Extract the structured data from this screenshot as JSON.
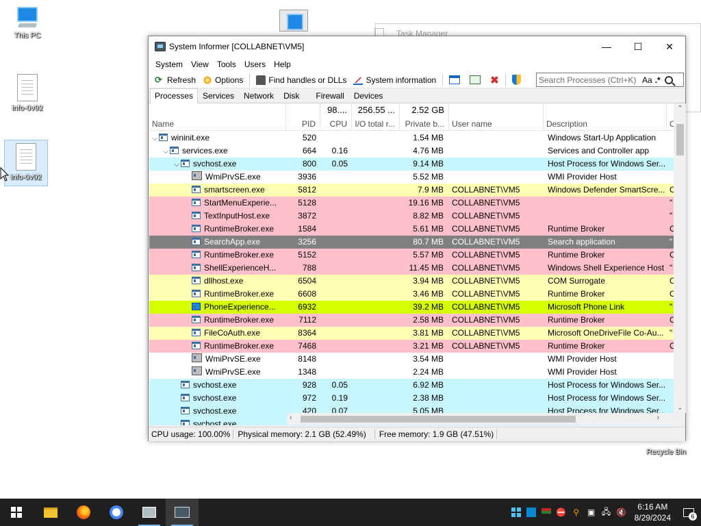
{
  "desktop": {
    "icons": [
      {
        "label": "This PC"
      },
      {
        "label": "info-0v92"
      },
      {
        "label": "info-0v92"
      }
    ],
    "recycle_label": "Recycle Bin"
  },
  "bg_window": {
    "title": "Task Manager"
  },
  "window": {
    "title": "System Informer [COLLABNET\\VM5]",
    "controls": {
      "minimize": "—",
      "maximize": "☐",
      "close": "✕"
    },
    "menu": [
      "System",
      "View",
      "Tools",
      "Users",
      "Help"
    ],
    "toolbar": {
      "refresh": "Refresh",
      "options": "Options",
      "find_handles": "Find handles or DLLs",
      "system_information": "System information"
    },
    "search": {
      "placeholder": "Search Processes (Ctrl+K)",
      "case_label": "Aa",
      "regex_label": ".*"
    },
    "tabs": [
      "Processes",
      "Services",
      "Network",
      "Disk",
      "Firewall",
      "Devices"
    ],
    "columns": {
      "name": "Name",
      "pid": "PID",
      "cpu": "CPU",
      "io": "I/O total r...",
      "private": "Private b...",
      "user": "User name",
      "desc": "Description",
      "extra": "C"
    },
    "totals": {
      "cpu": "98....",
      "io": "256.55 ...",
      "private": "2.52 GB"
    },
    "rows": [
      {
        "depth": 0,
        "exp": "v",
        "name": "wininit.exe",
        "pid": "520",
        "cpu": "",
        "priv": "1.54 MB",
        "user": "",
        "desc": "Windows Start-Up Application",
        "extra": "",
        "bg": "#ffffff",
        "icon": "proc"
      },
      {
        "depth": 1,
        "exp": "v",
        "name": "services.exe",
        "pid": "664",
        "cpu": "0.16",
        "priv": "4.76 MB",
        "user": "",
        "desc": "Services and Controller app",
        "extra": "",
        "bg": "#ffffff",
        "icon": "proc"
      },
      {
        "depth": 2,
        "exp": "v",
        "name": "svchost.exe",
        "pid": "800",
        "cpu": "0.05",
        "priv": "9.14 MB",
        "user": "",
        "desc": "Host Process for Windows Ser...",
        "extra": "",
        "bg": "#c8f6ff",
        "icon": "proc"
      },
      {
        "depth": 3,
        "exp": "",
        "name": "WmiPrvSE.exe",
        "pid": "3936",
        "cpu": "",
        "priv": "5.52 MB",
        "user": "",
        "desc": "WMI Provider Host",
        "extra": "",
        "bg": "#ffffff",
        "icon": "wmi"
      },
      {
        "depth": 3,
        "exp": "",
        "name": "smartscreen.exe",
        "pid": "5812",
        "cpu": "",
        "priv": "7.9 MB",
        "user": "COLLABNET\\VM5",
        "desc": "Windows Defender SmartScre...",
        "extra": "C",
        "bg": "#ffffb4",
        "icon": "proc"
      },
      {
        "depth": 3,
        "exp": "",
        "name": "StartMenuExperie...",
        "pid": "5128",
        "cpu": "",
        "priv": "19.16 MB",
        "user": "COLLABNET\\VM5",
        "desc": "",
        "extra": "\"",
        "bg": "#ffc0cb",
        "icon": "proc"
      },
      {
        "depth": 3,
        "exp": "",
        "name": "TextInputHost.exe",
        "pid": "3872",
        "cpu": "",
        "priv": "8.82 MB",
        "user": "COLLABNET\\VM5",
        "desc": "",
        "extra": "\"",
        "bg": "#ffc0cb",
        "icon": "proc"
      },
      {
        "depth": 3,
        "exp": "",
        "name": "RuntimeBroker.exe",
        "pid": "1584",
        "cpu": "",
        "priv": "5.61 MB",
        "user": "COLLABNET\\VM5",
        "desc": "Runtime Broker",
        "extra": "C",
        "bg": "#ffc0cb",
        "icon": "proc"
      },
      {
        "depth": 3,
        "exp": "",
        "name": "SearchApp.exe",
        "pid": "3256",
        "cpu": "",
        "priv": "80.7 MB",
        "user": "COLLABNET\\VM5",
        "desc": "Search application",
        "extra": "\"",
        "bg": "#808080",
        "icon": "proc"
      },
      {
        "depth": 3,
        "exp": "",
        "name": "RuntimeBroker.exe",
        "pid": "5152",
        "cpu": "",
        "priv": "5.57 MB",
        "user": "COLLABNET\\VM5",
        "desc": "Runtime Broker",
        "extra": "C",
        "bg": "#ffc0cb",
        "icon": "proc"
      },
      {
        "depth": 3,
        "exp": "",
        "name": "ShellExperienceH...",
        "pid": "788",
        "cpu": "",
        "priv": "11.45 MB",
        "user": "COLLABNET\\VM5",
        "desc": "Windows Shell Experience Host",
        "extra": "\"",
        "bg": "#ffc0cb",
        "icon": "proc"
      },
      {
        "depth": 3,
        "exp": "",
        "name": "dllhost.exe",
        "pid": "6504",
        "cpu": "",
        "priv": "3.94 MB",
        "user": "COLLABNET\\VM5",
        "desc": "COM Surrogate",
        "extra": "C",
        "bg": "#ffffb4",
        "icon": "proc"
      },
      {
        "depth": 3,
        "exp": "",
        "name": "RuntimeBroker.exe",
        "pid": "6608",
        "cpu": "",
        "priv": "3.46 MB",
        "user": "COLLABNET\\VM5",
        "desc": "Runtime Broker",
        "extra": "C",
        "bg": "#ffffb4",
        "icon": "proc"
      },
      {
        "depth": 3,
        "exp": "",
        "name": "PhoneExperience...",
        "pid": "6932",
        "cpu": "",
        "priv": "39.2 MB",
        "user": "COLLABNET\\VM5",
        "desc": "Microsoft Phone Link",
        "extra": "\"",
        "bg": "#d4ff00",
        "icon": "phone"
      },
      {
        "depth": 3,
        "exp": "",
        "name": "RuntimeBroker.exe",
        "pid": "7112",
        "cpu": "",
        "priv": "2.58 MB",
        "user": "COLLABNET\\VM5",
        "desc": "Runtime Broker",
        "extra": "C",
        "bg": "#ffc0cb",
        "icon": "proc"
      },
      {
        "depth": 3,
        "exp": "",
        "name": "FileCoAuth.exe",
        "pid": "8364",
        "cpu": "",
        "priv": "3.81 MB",
        "user": "COLLABNET\\VM5",
        "desc": "Microsoft OneDriveFile Co-Au...",
        "extra": "\"",
        "bg": "#ffffb4",
        "icon": "proc"
      },
      {
        "depth": 3,
        "exp": "",
        "name": "RuntimeBroker.exe",
        "pid": "7468",
        "cpu": "",
        "priv": "3.21 MB",
        "user": "COLLABNET\\VM5",
        "desc": "Runtime Broker",
        "extra": "C",
        "bg": "#ffc0cb",
        "icon": "proc"
      },
      {
        "depth": 3,
        "exp": "",
        "name": "WmiPrvSE.exe",
        "pid": "8148",
        "cpu": "",
        "priv": "3.54 MB",
        "user": "",
        "desc": "WMI Provider Host",
        "extra": "",
        "bg": "#ffffff",
        "icon": "wmi"
      },
      {
        "depth": 3,
        "exp": "",
        "name": "WmiPrvSE.exe",
        "pid": "1348",
        "cpu": "",
        "priv": "2.24 MB",
        "user": "",
        "desc": "WMI Provider Host",
        "extra": "",
        "bg": "#ffffff",
        "icon": "wmi"
      },
      {
        "depth": 2,
        "exp": "",
        "name": "svchost.exe",
        "pid": "928",
        "cpu": "0.05",
        "priv": "6.92 MB",
        "user": "",
        "desc": "Host Process for Windows Ser...",
        "extra": "",
        "bg": "#c8f6ff",
        "icon": "proc"
      },
      {
        "depth": 2,
        "exp": "",
        "name": "svchost.exe",
        "pid": "972",
        "cpu": "0.19",
        "priv": "2.38 MB",
        "user": "",
        "desc": "Host Process for Windows Ser...",
        "extra": "",
        "bg": "#c8f6ff",
        "icon": "proc"
      },
      {
        "depth": 2,
        "exp": "",
        "name": "svchost.exe",
        "pid": "420",
        "cpu": "0.07",
        "priv": "5.05 MB",
        "user": "",
        "desc": "Host Process for Windows Ser...",
        "extra": "",
        "bg": "#c8f6ff",
        "icon": "proc"
      },
      {
        "depth": 2,
        "exp": "",
        "name": "svchost.exe",
        "pid": "",
        "cpu": "",
        "priv": "",
        "user": "",
        "desc": "",
        "extra": "",
        "bg": "#c8f6ff",
        "icon": "proc"
      }
    ],
    "status": {
      "cpu": "CPU usage: 100.00%",
      "phys": "Physical memory: 2.1 GB (52.49%)",
      "free": "Free memory: 1.9 GB (47.51%)"
    }
  },
  "taskbar": {
    "time": "6:16 AM",
    "date": "8/29/2024",
    "notification_count": "6"
  },
  "colors": {
    "service": "#c8f6ff",
    "own_process": "#ffffb4",
    "immersive": "#ffc0cb",
    "suspended": "#808080",
    "highlight": "#d4ff00",
    "taskbar": "#1f1f1f"
  }
}
